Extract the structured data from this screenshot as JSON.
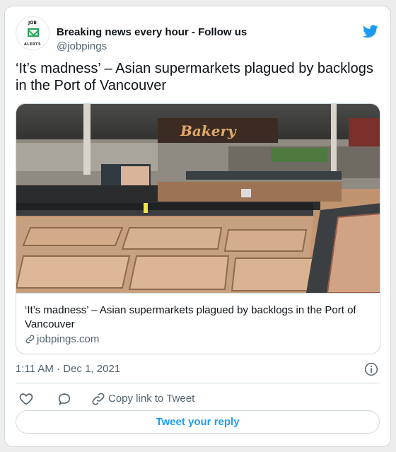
{
  "author": {
    "display_name": "Breaking news every hour - Follow us",
    "handle": "@jobpings",
    "avatar_text_top": "JOB",
    "avatar_text_bottom": "ALERTS",
    "avatar_icon": "envelope-icon"
  },
  "tweet": {
    "text": "‘It’s madness’ – Asian supermarkets plagued by backlogs in the Port of Vancouver",
    "timestamp": "1:11 AM · Dec 1, 2021"
  },
  "link_card": {
    "image_description_icon": "photo",
    "sign_text": "Bakery",
    "title": "‘It’s madness’ – Asian supermarkets plagued by backlogs in the Port of Vancouver",
    "domain": "jobpings.com"
  },
  "actions": {
    "like_icon": "heart-icon",
    "reply_icon": "comment-icon",
    "copy_icon": "link-icon",
    "copy_label": "Copy link to Tweet",
    "reply_button_label": "Tweet your reply"
  },
  "colors": {
    "twitter_blue": "#1d9bf0",
    "secondary_text": "#536471",
    "border": "#cfd9de"
  }
}
